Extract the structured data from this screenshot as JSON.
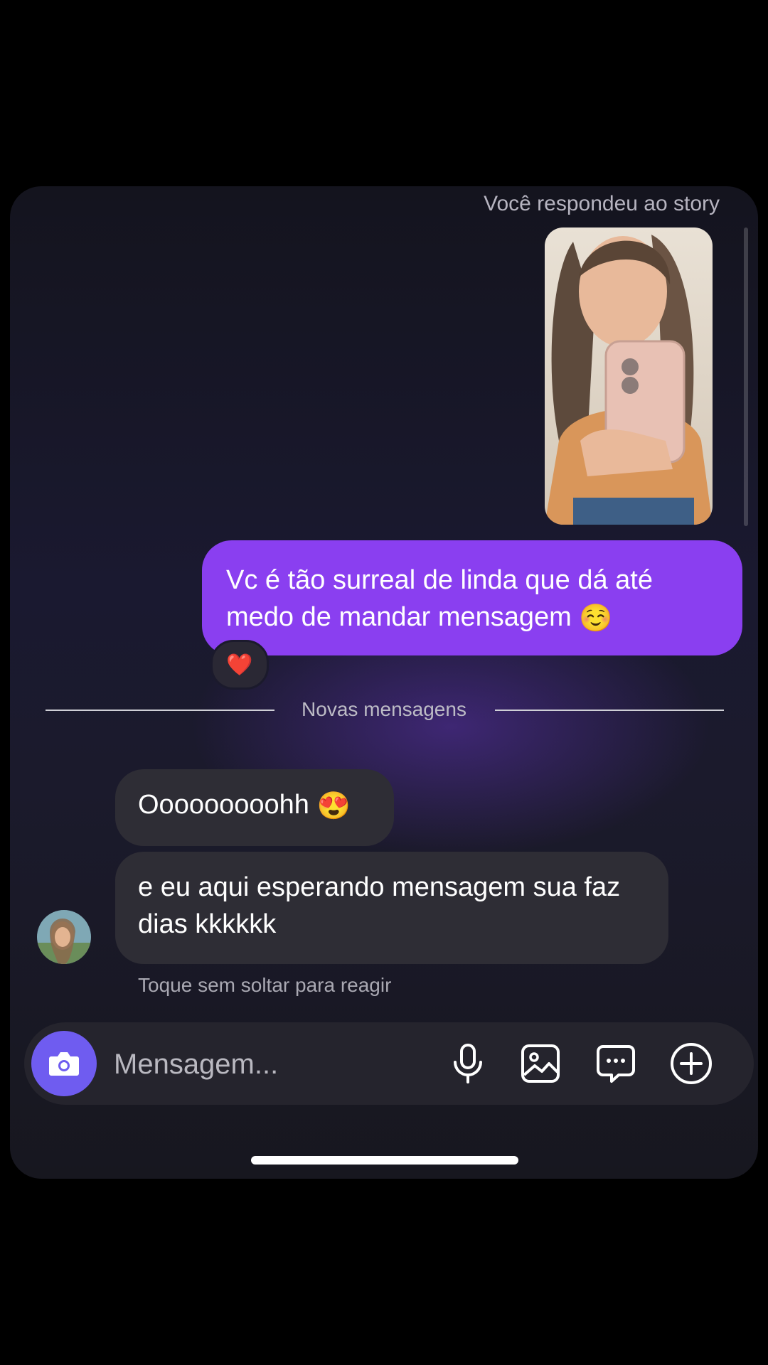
{
  "thread": {
    "story_caption": "Você respondeu ao story",
    "sent_message": "Vc é tão surreal de linda que dá até medo de mandar mensagem",
    "sent_emoji": "☺️",
    "reaction": "❤️",
    "divider_label": "Novas mensagens",
    "received": [
      {
        "text": "Ooooooooohh",
        "emoji": "😍"
      },
      {
        "text": "e eu aqui esperando mensagem sua faz dias kkkkkk"
      }
    ],
    "hint": "Toque sem soltar para reagir"
  },
  "composer": {
    "placeholder": "Mensagem...",
    "icons": [
      "camera-icon",
      "microphone-icon",
      "gallery-icon",
      "sticker-icon",
      "add-icon"
    ]
  },
  "colors": {
    "sent_bubble": "#8a3ff0",
    "received_bubble": "#2e2d35",
    "camera_button": "#6f5cf0"
  }
}
